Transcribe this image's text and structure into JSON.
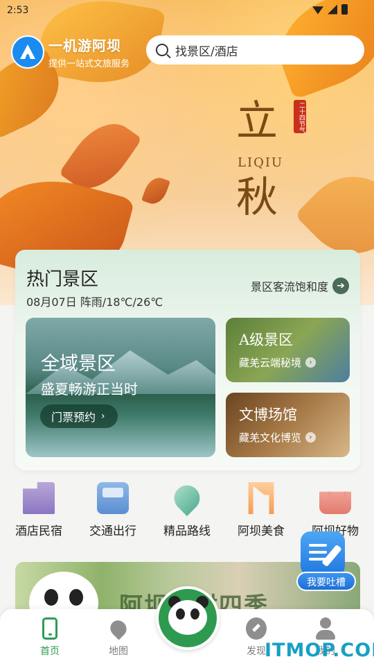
{
  "status_bar": {
    "time": "2:53"
  },
  "header": {
    "app_name": "一机游阿坝",
    "app_tagline": "提供一站式文旅服务",
    "search_placeholder": "找景区/酒店"
  },
  "banner": {
    "term_char_1": "立",
    "term_char_2": "秋",
    "term_pinyin": "LIQIU",
    "term_seal": "二十四节气"
  },
  "hot_spots": {
    "title": "热门景区",
    "weather": "08月07日 阵雨/18℃/26℃",
    "saturation_link": "景区客流饱和度",
    "main_tile": {
      "title": "全域景区",
      "subtitle": "盛夏畅游正当时",
      "button": "门票预约"
    },
    "tile_a": {
      "title": "A级景区",
      "subtitle": "藏羌云端秘境"
    },
    "tile_b": {
      "title": "文博场馆",
      "subtitle": "藏羌文化博览"
    }
  },
  "categories": [
    {
      "label": "酒店民宿",
      "icon": "hotel-icon"
    },
    {
      "label": "交通出行",
      "icon": "bus-icon"
    },
    {
      "label": "精品路线",
      "icon": "route-icon"
    },
    {
      "label": "阿坝美食",
      "icon": "food-icon"
    },
    {
      "label": "阿坝好物",
      "icon": "shopping-bag-icon"
    }
  ],
  "promo": {
    "title": "阿坝乡村四季"
  },
  "feedback": {
    "label": "我要吐槽"
  },
  "tabbar": {
    "tabs": [
      {
        "label": "首页",
        "icon": "home-icon",
        "active": true
      },
      {
        "label": "地图",
        "icon": "map-pin-icon",
        "active": false
      },
      {
        "label": "发现",
        "icon": "compass-icon",
        "active": false
      },
      {
        "label": "我的",
        "icon": "user-icon",
        "active": false
      }
    ]
  },
  "watermark": "ITMOP.COM",
  "colors": {
    "accent": "#2f9b55",
    "brand_blue": "#1a8cf0"
  }
}
